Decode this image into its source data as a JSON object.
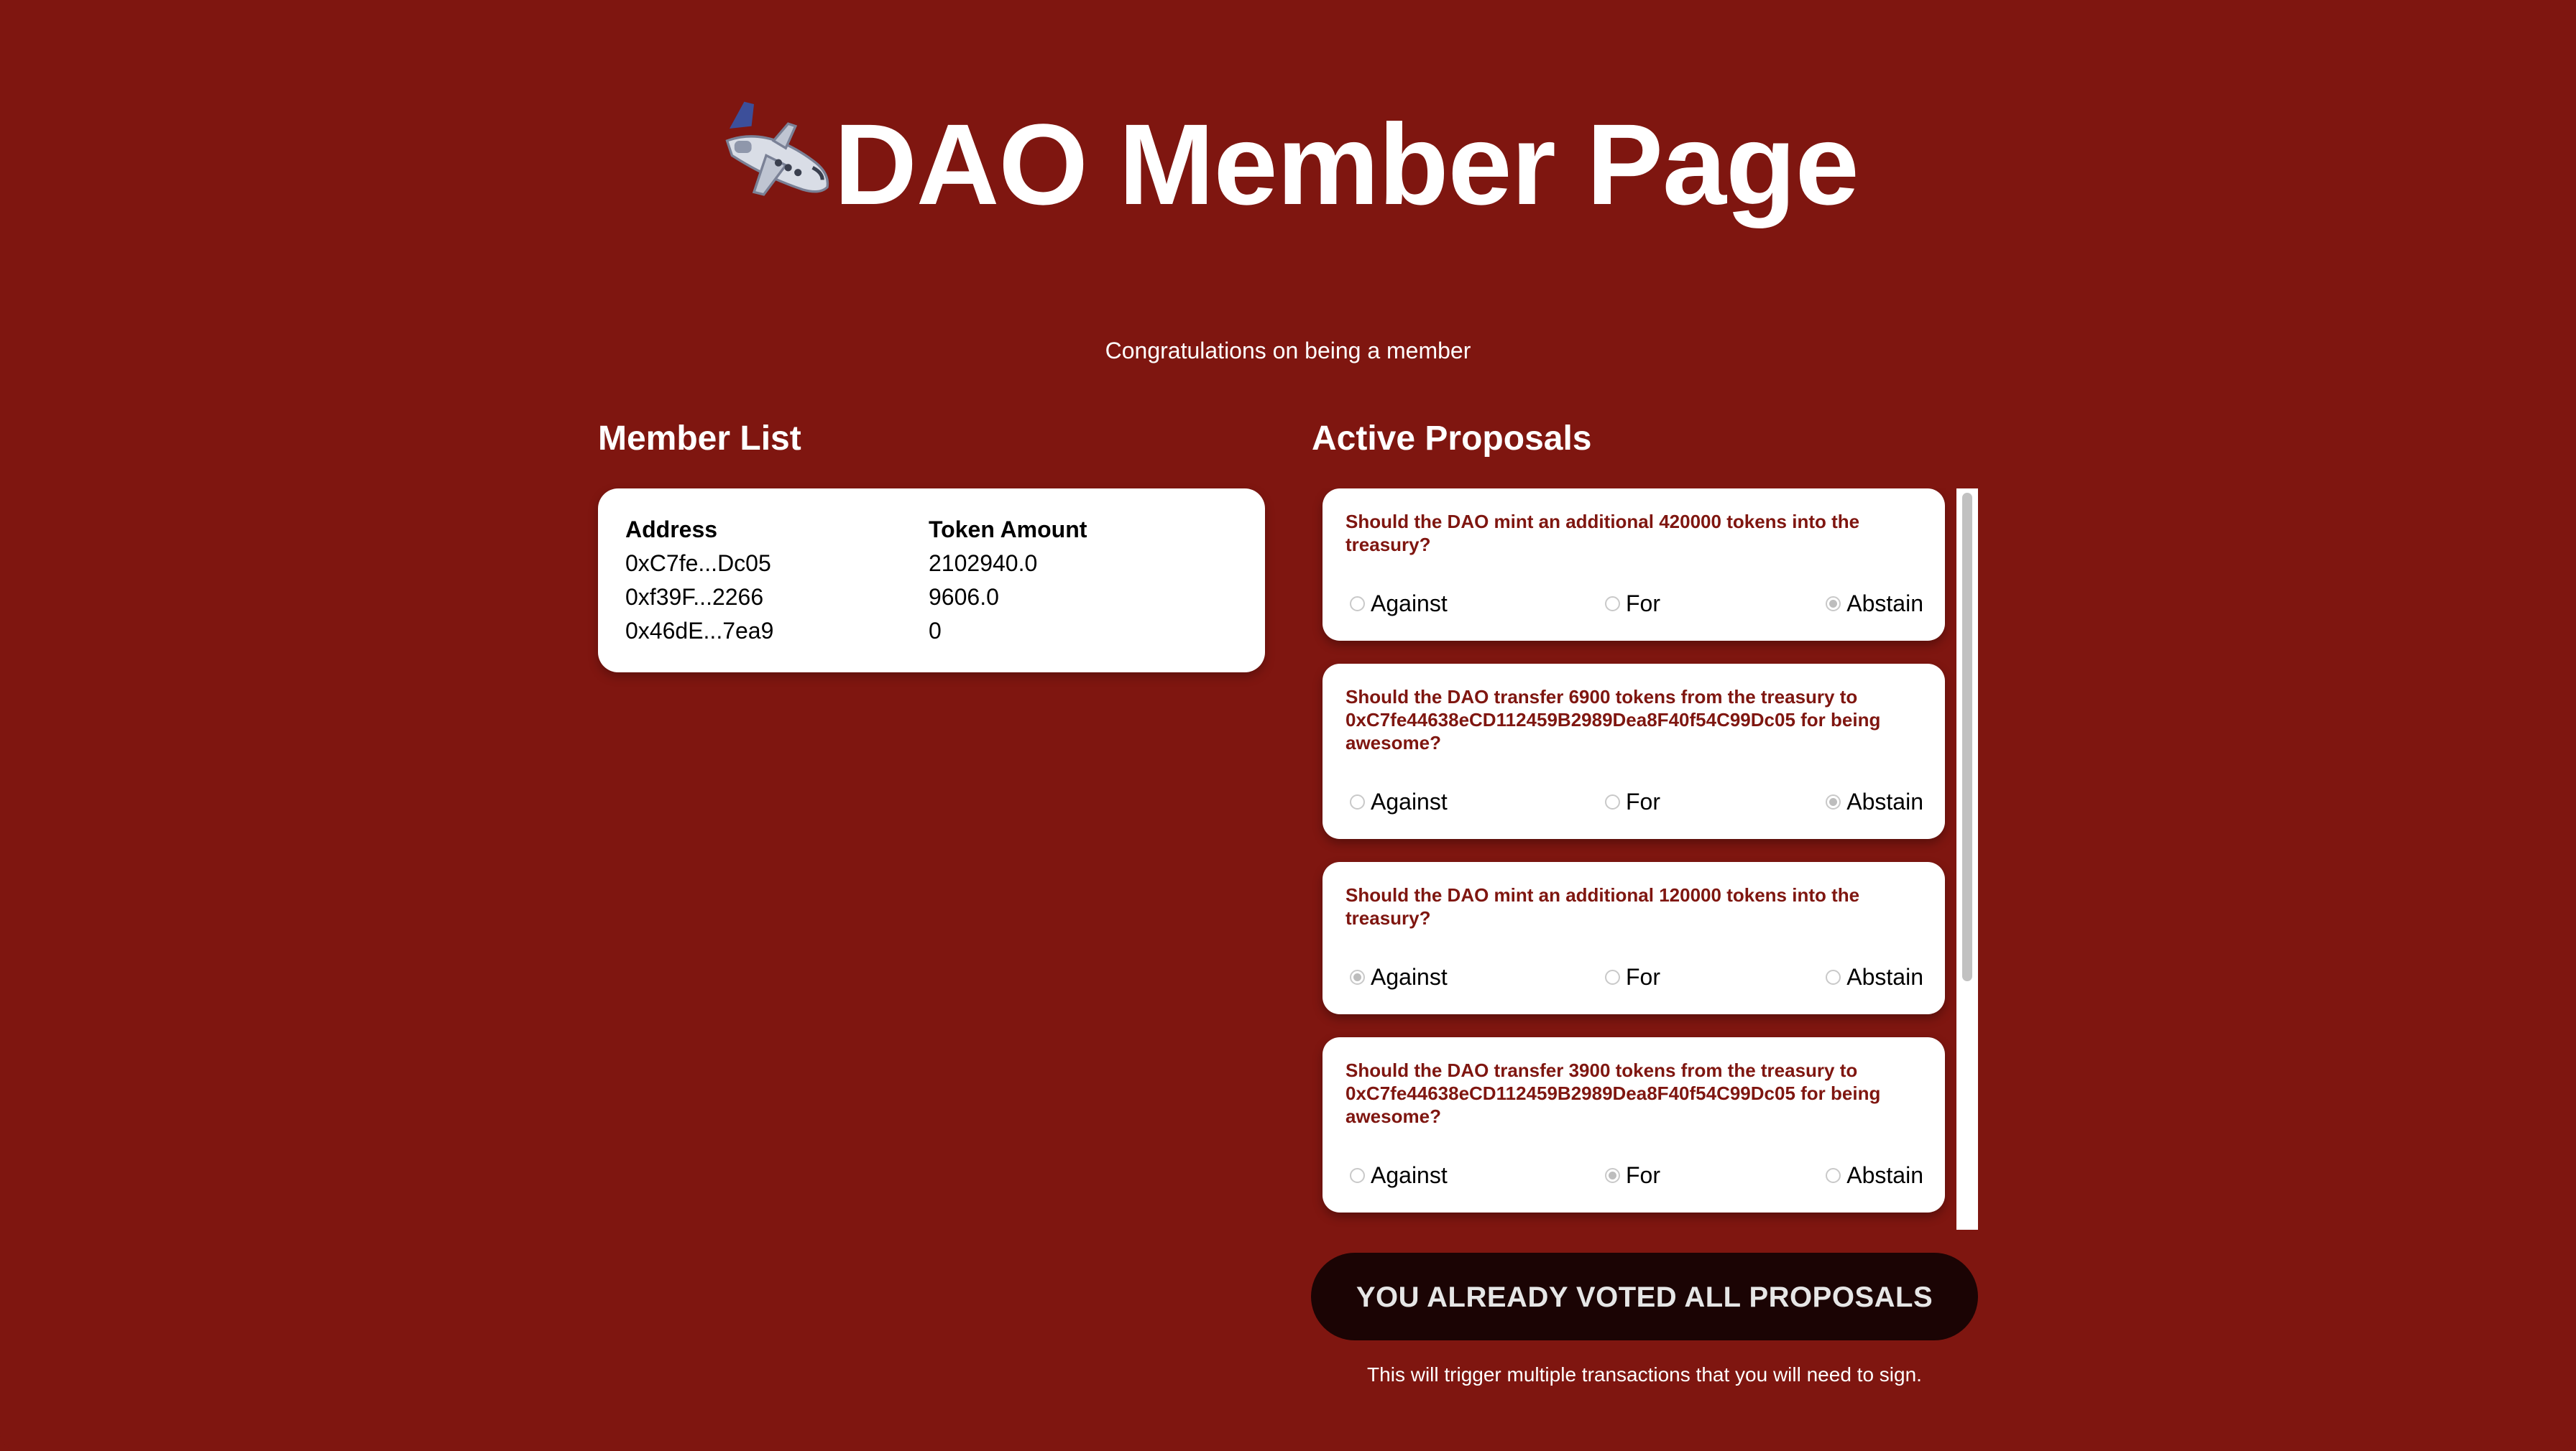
{
  "header": {
    "title": "DAO Member Page",
    "title_icon": "airplane-icon",
    "subtitle": "Congratulations on being a member"
  },
  "member_list": {
    "heading": "Member List",
    "columns": [
      "Address",
      "Token Amount"
    ],
    "rows": [
      {
        "address": "0xC7fe...Dc05",
        "amount": "2102940.0"
      },
      {
        "address": "0xf39F...2266",
        "amount": "9606.0"
      },
      {
        "address": "0x46dE...7ea9",
        "amount": "0"
      }
    ]
  },
  "proposals": {
    "heading": "Active Proposals",
    "vote_options": [
      "Against",
      "For",
      "Abstain"
    ],
    "items": [
      {
        "question": "Should the DAO mint an additional 420000 tokens into the treasury?",
        "selected": "Abstain"
      },
      {
        "question": "Should the DAO transfer 6900 tokens from the treasury to 0xC7fe44638eCD112459B2989Dea8F40f54C99Dc05 for being awesome?",
        "selected": "Abstain"
      },
      {
        "question": "Should the DAO mint an additional 120000 tokens into the treasury?",
        "selected": "Against"
      },
      {
        "question": "Should the DAO transfer 3900 tokens from the treasury to 0xC7fe44638eCD112459B2989Dea8F40f54C99Dc05 for being awesome?",
        "selected": "For"
      }
    ]
  },
  "submit": {
    "label": "YOU ALREADY VOTED ALL PROPOSALS",
    "note": "This will trigger multiple transactions that you will need to sign."
  },
  "colors": {
    "background": "#7f1610",
    "question_text": "#7f1610",
    "button_bg": "#1b0404"
  }
}
